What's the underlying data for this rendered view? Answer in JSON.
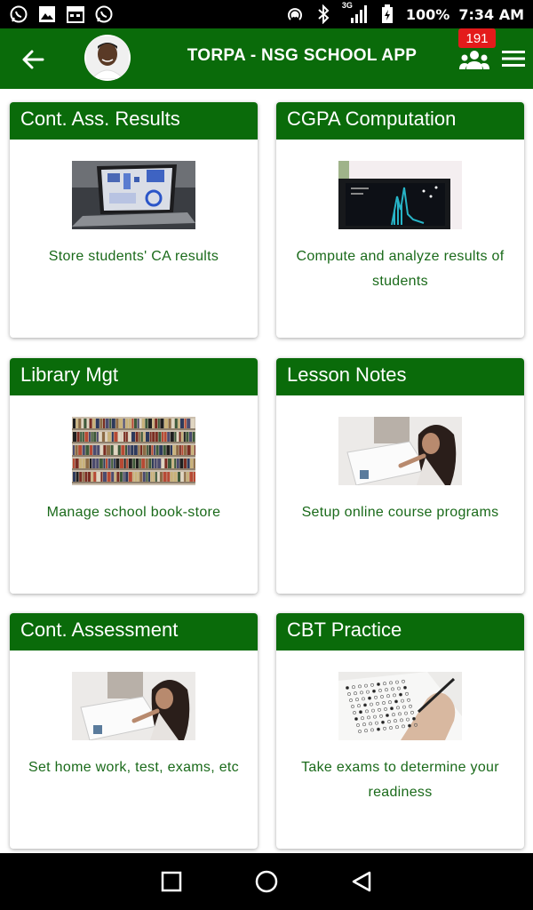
{
  "status_bar": {
    "left_icons": [
      "whatsapp-icon",
      "image-icon",
      "calendar-icon",
      "whatsapp-icon"
    ],
    "right_icons": [
      "hotspot-icon",
      "bluetooth-icon",
      "signal-3g-icon",
      "battery-icon"
    ],
    "network": "3G",
    "battery": "100%",
    "time": "7:34 AM"
  },
  "app_bar": {
    "title": "TORPA - NSG SCHOOL APP",
    "notification_count": "191",
    "background": "#0a6b0a"
  },
  "cards": [
    {
      "title": "Cont. Ass. Results",
      "description": "Store students' CA results",
      "image": "laptop-analytics"
    },
    {
      "title": "CGPA Computation",
      "description": "Compute and analyze results of students",
      "image": "laptop-chart"
    },
    {
      "title": "Library Mgt",
      "description": "Manage school book-store",
      "image": "bookshelves"
    },
    {
      "title": "Lesson Notes",
      "description": "Setup online course programs",
      "image": "student-writing"
    },
    {
      "title": "Cont. Assessment",
      "description": "Set home work, test, exams, etc",
      "image": "student-writing"
    },
    {
      "title": "CBT Practice",
      "description": "Take exams to determine your readiness",
      "image": "answer-sheet"
    }
  ],
  "nav_bar": {
    "buttons": [
      "recents-square-icon",
      "home-circle-icon",
      "back-triangle-icon"
    ]
  }
}
